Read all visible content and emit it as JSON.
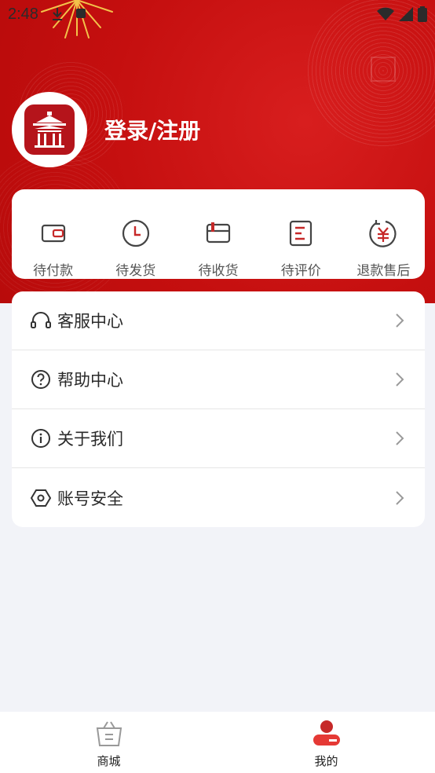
{
  "status_bar": {
    "time": "2:48"
  },
  "profile": {
    "login_label": "登录/注册"
  },
  "orders": [
    {
      "label": "待付款",
      "icon": "wallet-icon"
    },
    {
      "label": "待发货",
      "icon": "clock-icon"
    },
    {
      "label": "待收货",
      "icon": "box-icon"
    },
    {
      "label": "待评价",
      "icon": "document-icon"
    },
    {
      "label": "退款售后",
      "icon": "refund-yen-icon"
    }
  ],
  "menu": [
    {
      "label": "客服中心",
      "icon": "headset-icon"
    },
    {
      "label": "帮助中心",
      "icon": "help-icon"
    },
    {
      "label": "关于我们",
      "icon": "info-icon"
    },
    {
      "label": "账号安全",
      "icon": "security-icon"
    }
  ],
  "tabbar": [
    {
      "label": "商城",
      "icon": "shopping-basket-icon",
      "active": false
    },
    {
      "label": "我的",
      "icon": "profile-icon",
      "active": true
    }
  ],
  "colors": {
    "brand": "#c91414",
    "icon_accent": "#c62828",
    "background": "#f2f3f8"
  }
}
